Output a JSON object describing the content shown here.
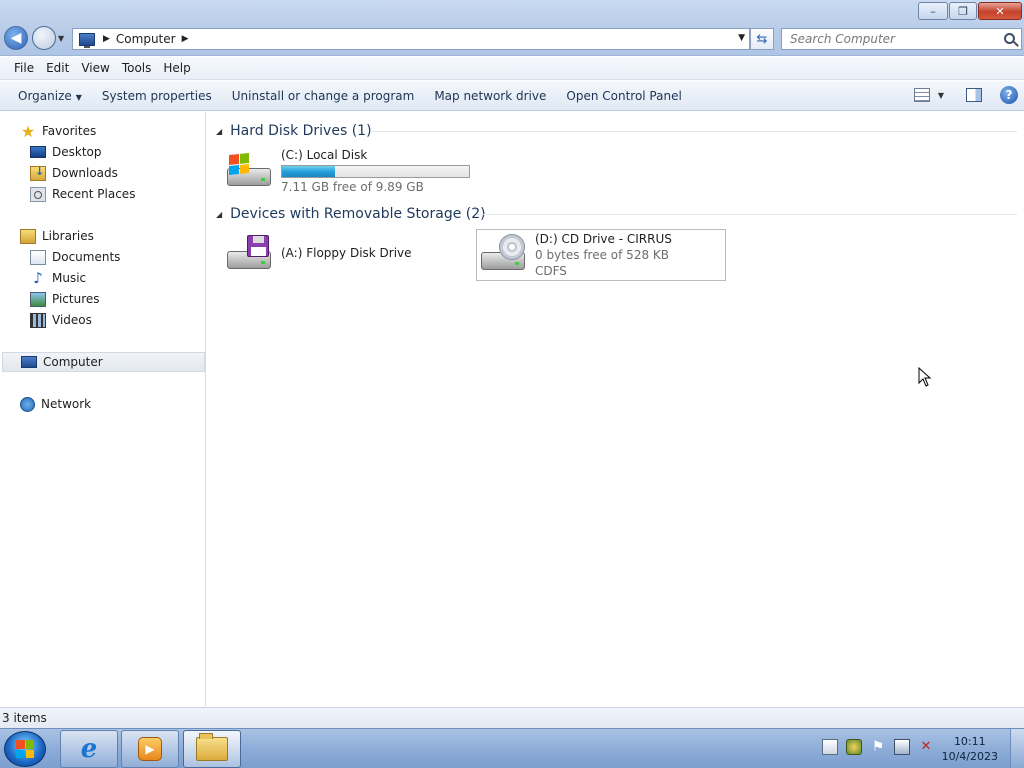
{
  "window": {
    "caption_buttons": {
      "minimize": "–",
      "maximize": "❐",
      "close": "✕"
    }
  },
  "address": {
    "location": "Computer",
    "search_placeholder": "Search Computer"
  },
  "menu": [
    "File",
    "Edit",
    "View",
    "Tools",
    "Help"
  ],
  "commands": {
    "organize": "Organize",
    "system_properties": "System properties",
    "uninstall": "Uninstall or change a program",
    "map_drive": "Map network drive",
    "control_panel": "Open Control Panel"
  },
  "nav": {
    "favorites": "Favorites",
    "desktop": "Desktop",
    "downloads": "Downloads",
    "recent": "Recent Places",
    "libraries": "Libraries",
    "documents": "Documents",
    "music": "Music",
    "pictures": "Pictures",
    "videos": "Videos",
    "computer": "Computer",
    "network": "Network"
  },
  "groups": {
    "hdd": "Hard Disk Drives (1)",
    "removable": "Devices with Removable Storage (2)"
  },
  "drives": {
    "c": {
      "name": "(C:) Local Disk",
      "free": "7.11 GB free of 9.89 GB",
      "used_fraction": 0.281
    },
    "a": {
      "name": "(A:) Floppy Disk Drive"
    },
    "d": {
      "name": "(D:) CD Drive - CIRRUS",
      "free": "0 bytes free of 528 KB",
      "fs": "CDFS"
    }
  },
  "status": {
    "items": "3 items"
  },
  "taskbar": {
    "time": "10:11",
    "date": "10/4/2023"
  },
  "colors": {
    "accent": "#26a0da",
    "nav_selected": "#e3e8ef"
  }
}
